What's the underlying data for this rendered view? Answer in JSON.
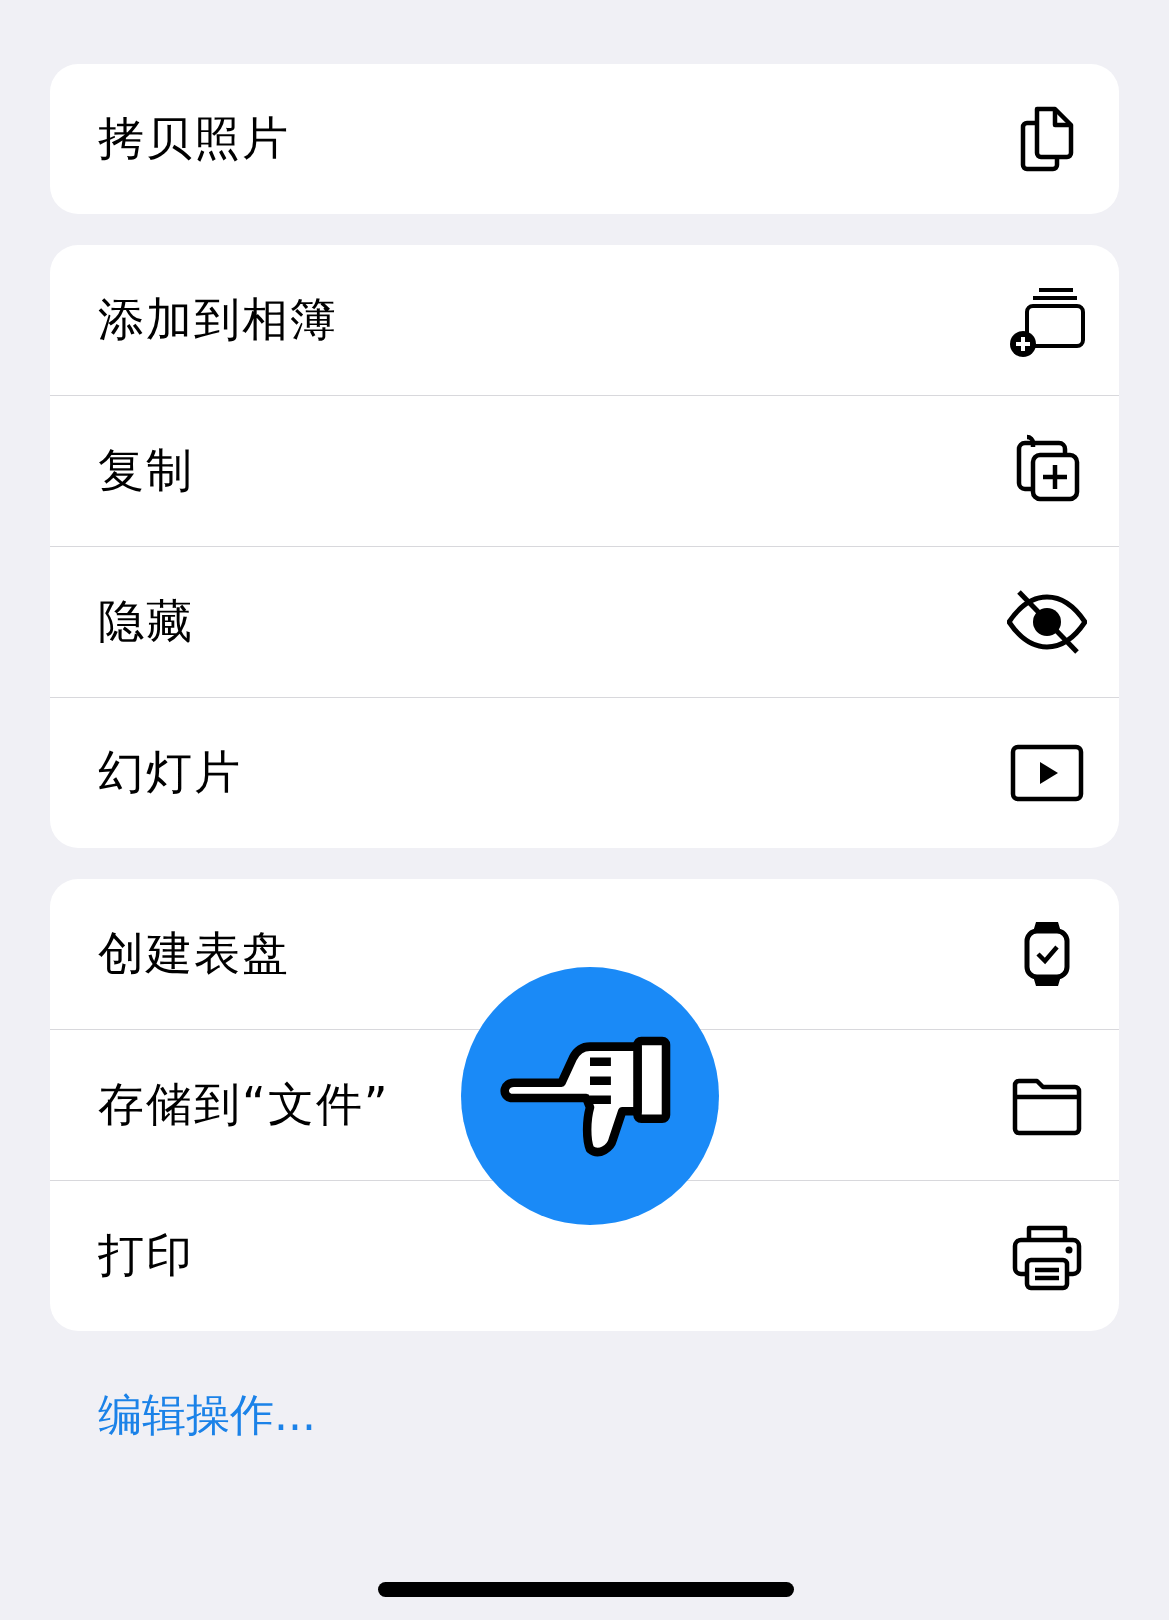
{
  "groups": [
    {
      "items": [
        {
          "label": "拷贝照片",
          "kind": "copy-docs"
        }
      ]
    },
    {
      "items": [
        {
          "label": "添加到相簿",
          "kind": "album-add"
        },
        {
          "label": "复制",
          "kind": "duplicate"
        },
        {
          "label": "隐藏",
          "kind": "eye-slash"
        },
        {
          "label": "幻灯片",
          "kind": "play"
        }
      ]
    },
    {
      "items": [
        {
          "label": "创建表盘",
          "kind": "watch"
        },
        {
          "label": "存储到“文件”",
          "kind": "folder"
        },
        {
          "label": "打印",
          "kind": "printer"
        }
      ]
    }
  ],
  "edit_link": "编辑操作...",
  "overlay": {
    "kind": "pointing-hand"
  }
}
